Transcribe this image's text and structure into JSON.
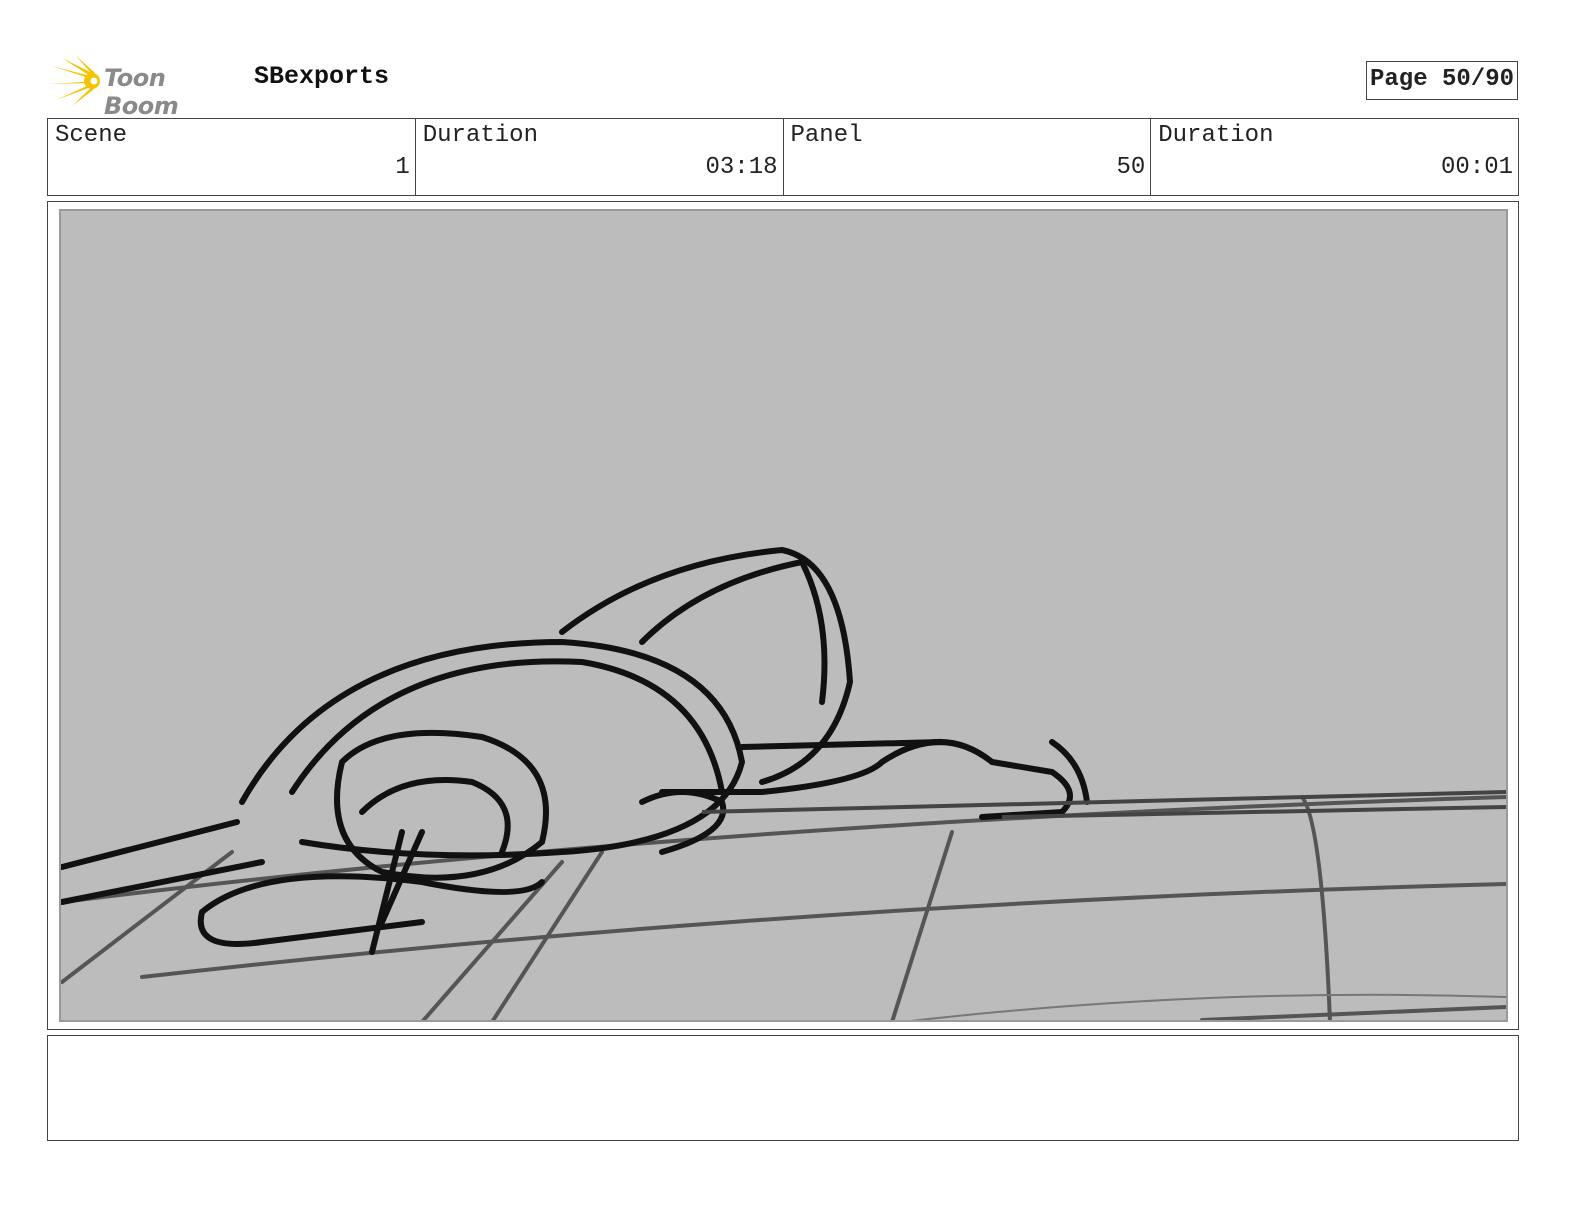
{
  "header": {
    "logo_text": "Toon Boom",
    "title": "SBexports",
    "page": "Page 50/90"
  },
  "info": [
    {
      "label": "Scene",
      "value": "1"
    },
    {
      "label": "Duration",
      "value": "03:18"
    },
    {
      "label": "Panel",
      "value": "50"
    },
    {
      "label": "Duration",
      "value": "00:01"
    }
  ],
  "colors": {
    "logo_star": "#f5c400",
    "panel_bg": "#bcbcbc"
  }
}
